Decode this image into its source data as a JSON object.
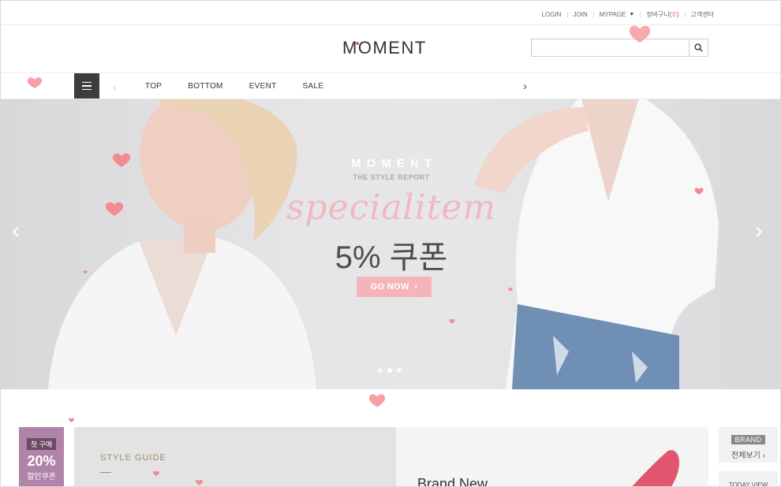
{
  "util_nav": {
    "login": "LOGIN",
    "join": "JOIN",
    "mypage": "MYPAGE",
    "cart_label": "장바구니(",
    "cart_count": "0",
    "cart_close": ")",
    "support": "고객센터"
  },
  "header": {
    "logo": "MOMENT",
    "search_placeholder": "",
    "search_icon": "search-icon"
  },
  "nav": {
    "menu_icon": "hamburger-icon",
    "items": [
      "TOP",
      "BOTTOM",
      "EVENT",
      "SALE"
    ]
  },
  "hero": {
    "brand": "MOMENT",
    "subtitle": "THE STYLE REPORT",
    "script": "specialitem",
    "coupon": "5% 쿠폰",
    "cta": "GO NOW",
    "slides": 3,
    "active_slide": 2
  },
  "bottom": {
    "coupon_tag": {
      "line1": "첫 구매",
      "line2": "20%",
      "line3": "할인쿠폰"
    },
    "style_guide": "STYLE GUIDE",
    "brand_new": "Brand New",
    "brand_tag": "BRAND",
    "brand_all": "전체보기",
    "today_view": "TODAY VIEW"
  },
  "colors": {
    "accent_pink": "#f3b4ba",
    "heart": "#f28b93",
    "menu_dark": "#3d3d3d",
    "coupon_purple": "#b083a8"
  }
}
